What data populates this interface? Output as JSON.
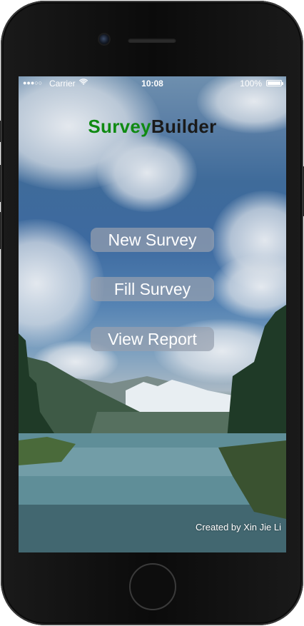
{
  "status_bar": {
    "signal": "●●●○○",
    "carrier": "Carrier",
    "wifi_icon": "wifi-icon",
    "time": "10:08",
    "battery_percent": "100%",
    "battery_level": 1.0
  },
  "app": {
    "title_part1": "Survey",
    "title_part2": "Builder",
    "title_part1_color": "#0f8a12",
    "title_part2_color": "#1a1a1a"
  },
  "menu": {
    "new_survey": "New Survey",
    "fill_survey": "Fill Survey",
    "view_report": "View Report"
  },
  "footer": {
    "credit": "Created by Xin Jie Li"
  }
}
